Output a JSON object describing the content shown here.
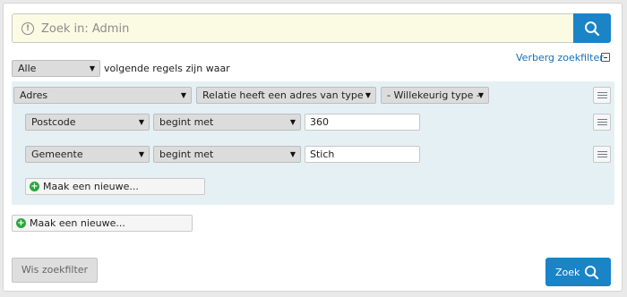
{
  "search": {
    "placeholder": "Zoek in: Admin"
  },
  "match": {
    "selected": "Alle",
    "suffix": "volgende regels zijn waar"
  },
  "toggle_filter_label": "Verberg zoekfilter",
  "group": {
    "field": "Adres",
    "relation": "Relatie heeft een adres van type",
    "type": "- Willekeurig type -",
    "rules": [
      {
        "field": "Postcode",
        "operator": "begint met",
        "value": "360"
      },
      {
        "field": "Gemeente",
        "operator": "begint met",
        "value": "Stich"
      }
    ],
    "add_label": "Maak een nieuwe..."
  },
  "add_root_label": "Maak een nieuwe...",
  "clear_label": "Wis zoekfilter",
  "submit_label": "Zoek",
  "colors": {
    "accent": "#1a84c7",
    "search_bg": "#fbfbe3",
    "group_bg": "#e5f0f5",
    "add_green": "#2aa640"
  }
}
